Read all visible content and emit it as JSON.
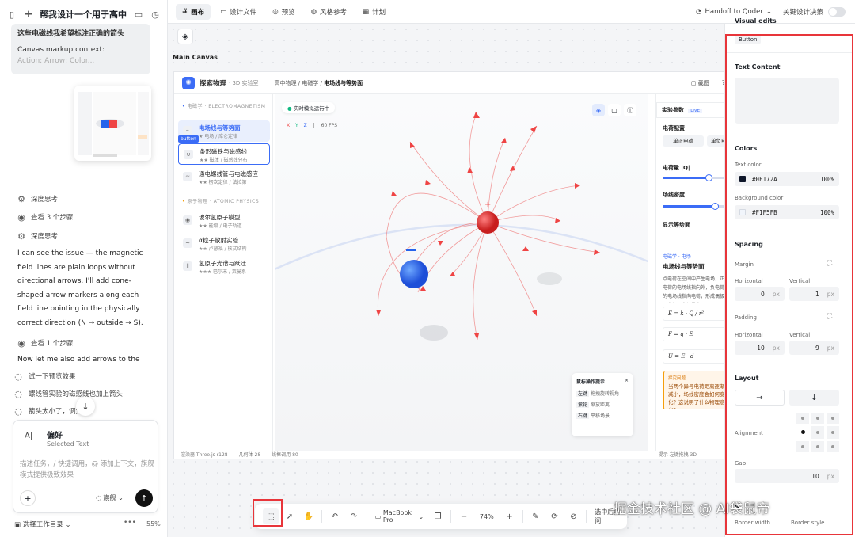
{
  "chat": {
    "title": "帮我设计一个用于高中...",
    "context_text": "这些电磁线我希望标注正确的箭头",
    "context_label": "Canvas markup context:",
    "context_more": "Action: Arrow; Color...",
    "thinking1": "深度思考",
    "steps3": "查看 3 个步骤",
    "thinking2": "深度思考",
    "message1": "I can see the issue — the magnetic field lines are plain loops without directional arrows. I'll add cone-shaped arrow markers along each field line pointing in the physically correct direction (N → outside → S).",
    "steps1": "查看 1 个步骤",
    "message2": "Now let me also add arrows to the",
    "suggestions": [
      "试一下预览效果",
      "螺线管实验的磁感线也加上箭头",
      "箭头太小了，调大"
    ],
    "pref_title": "偏好",
    "pref_sub": "Selected Text",
    "input_placeholder": "描述任务，/ 快捷调用，@ 添加上下文，旗舰模式提供极致效果",
    "model": "旗舰",
    "workspace": "选择工作目录",
    "usage": "55%"
  },
  "topbar": {
    "tabs": [
      "画布",
      "设计文件",
      "预览",
      "风格参考",
      "计划"
    ],
    "handoff": "Handoff to Qoder",
    "toggle_label": "关键设计决策"
  },
  "canvas": {
    "label": "Main Canvas",
    "frame": {
      "brand": "探索物理",
      "brand_sub": "· 3D 实验室",
      "breadcrumb": [
        "高中物理",
        "电磁学",
        "电场线与等势面"
      ],
      "shot": "截图",
      "sections": [
        "电磁学 · ELECTROMAGNETISM",
        "原子物理 · ATOMIC PHYSICS"
      ],
      "nav": [
        {
          "title": "电场线与等势面",
          "sub": "★ 电场 / 库仑定律"
        },
        {
          "title": "条形磁铁与磁感线",
          "sub": "★★ 磁体 / 磁感线分布"
        },
        {
          "title": "通电螺线管与电磁感应",
          "sub": "★★ 楞次定律 / 法拉第"
        },
        {
          "title": "玻尔氢原子模型",
          "sub": "★★ 能级 / 电子轨道"
        },
        {
          "title": "α粒子散射实验",
          "sub": "★★ 卢瑟福 / 核式结构"
        },
        {
          "title": "氢原子光谱与跃迁",
          "sub": "★★★ 巴尔末 / 莱曼系"
        }
      ],
      "button_tag": "button",
      "live": "实时模拟运行中",
      "axes": [
        "X",
        "Y",
        "Z"
      ],
      "fps": "60 FPS",
      "params_title": "实验参数",
      "params_live": "LIVE",
      "charge_config": "电荷配置",
      "single_charge": "单正电荷",
      "neg_charge": "单负电",
      "charge_q": "电荷量 |Q|",
      "line_density": "场线密度",
      "show_equi": "显示等势面",
      "info_tag": "电磁学 · 电场",
      "info_title": "电场线与等势面",
      "info_desc": "点电荷在空间中产生电场，正电荷的电场线指向外，负电荷的电场线指向电荷，形成偶极子电场。电场线密",
      "formulas": [
        "E = k · Q / r²",
        "F = q · E",
        "U = E · d"
      ],
      "explore_title": "探究问题",
      "explore_text": "当两个异号电荷距离逐渐减小，场线密度会如何变化？这说明了什么物理意义？",
      "mouse_title": "鼠标操作提示",
      "mouse_hints": [
        [
          "左键",
          "拖拽旋转视角"
        ],
        [
          "滚轮",
          "缩放距离"
        ],
        [
          "右键",
          "平移场景"
        ]
      ],
      "status": [
        "渲染器 Three.js r128",
        "几何体 28",
        "线框调用 80"
      ],
      "status_right": "提示 左键拖拽 3D"
    }
  },
  "inspector": {
    "section_visual": "Visual edits",
    "element_tag": "Button",
    "text_content": "Text Content",
    "colors": "Colors",
    "text_color_label": "Text color",
    "text_color": "#0F172A",
    "text_color_pct": "100%",
    "bg_color_label": "Background color",
    "bg_color": "#F1F5FB",
    "bg_color_pct": "100%",
    "spacing": "Spacing",
    "margin": "Margin",
    "horizontal": "Horizontal",
    "vertical": "Vertical",
    "margin_h": "0",
    "margin_v": "1",
    "padding": "Padding",
    "padding_h": "10",
    "padding_v": "9",
    "unit": "px",
    "layout": "Layout",
    "alignment": "Alignment",
    "gap": "Gap",
    "gap_value": "10",
    "border_label_w": "Border width",
    "border_label_s": "Border style",
    "border_partial": "B"
  },
  "bottombar": {
    "device": "MacBook Pro",
    "zoom": "74%",
    "select_hint": "选中后提问"
  },
  "watermark": "掘金技术社区 @ AI袋鼠帝",
  "colors": {
    "accent": "#3b6cf6",
    "red": "#e8353a",
    "positive": "#ef4444",
    "negative": "#2563eb"
  }
}
